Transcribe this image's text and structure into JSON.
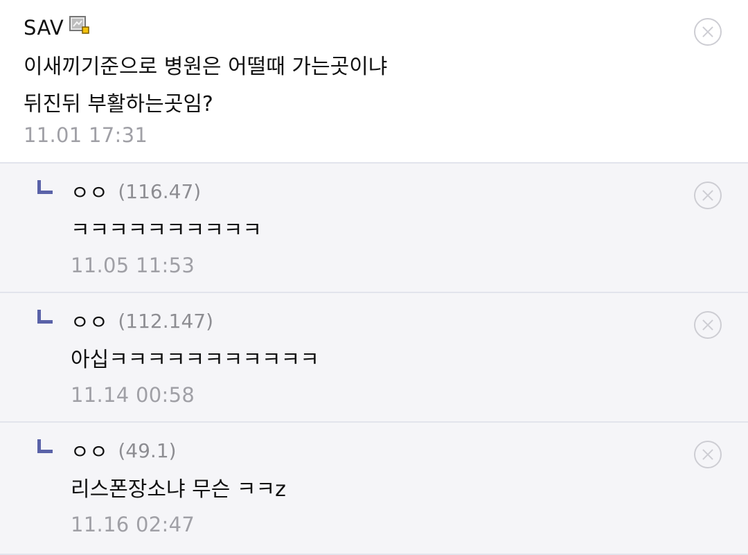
{
  "post": {
    "author": "SAV",
    "badge_icon": "fixed-nick-badge-icon",
    "lines": [
      "이새끼기준으로 병원은 어떨때 가는곳이냐",
      "뒤진뒤 부활하는곳임?"
    ],
    "timestamp": "11.01 17:31"
  },
  "replies": [
    {
      "author": "ㅇㅇ",
      "ip": "(116.47)",
      "text": "ㅋㅋㅋㅋㅋㅋㅋㅋㅋㅋ",
      "timestamp": "11.05 11:53"
    },
    {
      "author": "ㅇㅇ",
      "ip": "(112.147)",
      "text": "아십ㅋㅋㅋㅋㅋㅋㅋㅋㅋㅋㅋ",
      "timestamp": "11.14 00:58"
    },
    {
      "author": "ㅇㅇ",
      "ip": "(49.1)",
      "text": "리스폰장소냐 무슨 ㅋㅋz",
      "timestamp": "11.16 02:47"
    }
  ],
  "colors": {
    "reply_background": "#f5f5f8",
    "reply_arrow": "#5a62a8",
    "timestamp": "#a0a0a6",
    "divider": "#e2e4ec"
  }
}
